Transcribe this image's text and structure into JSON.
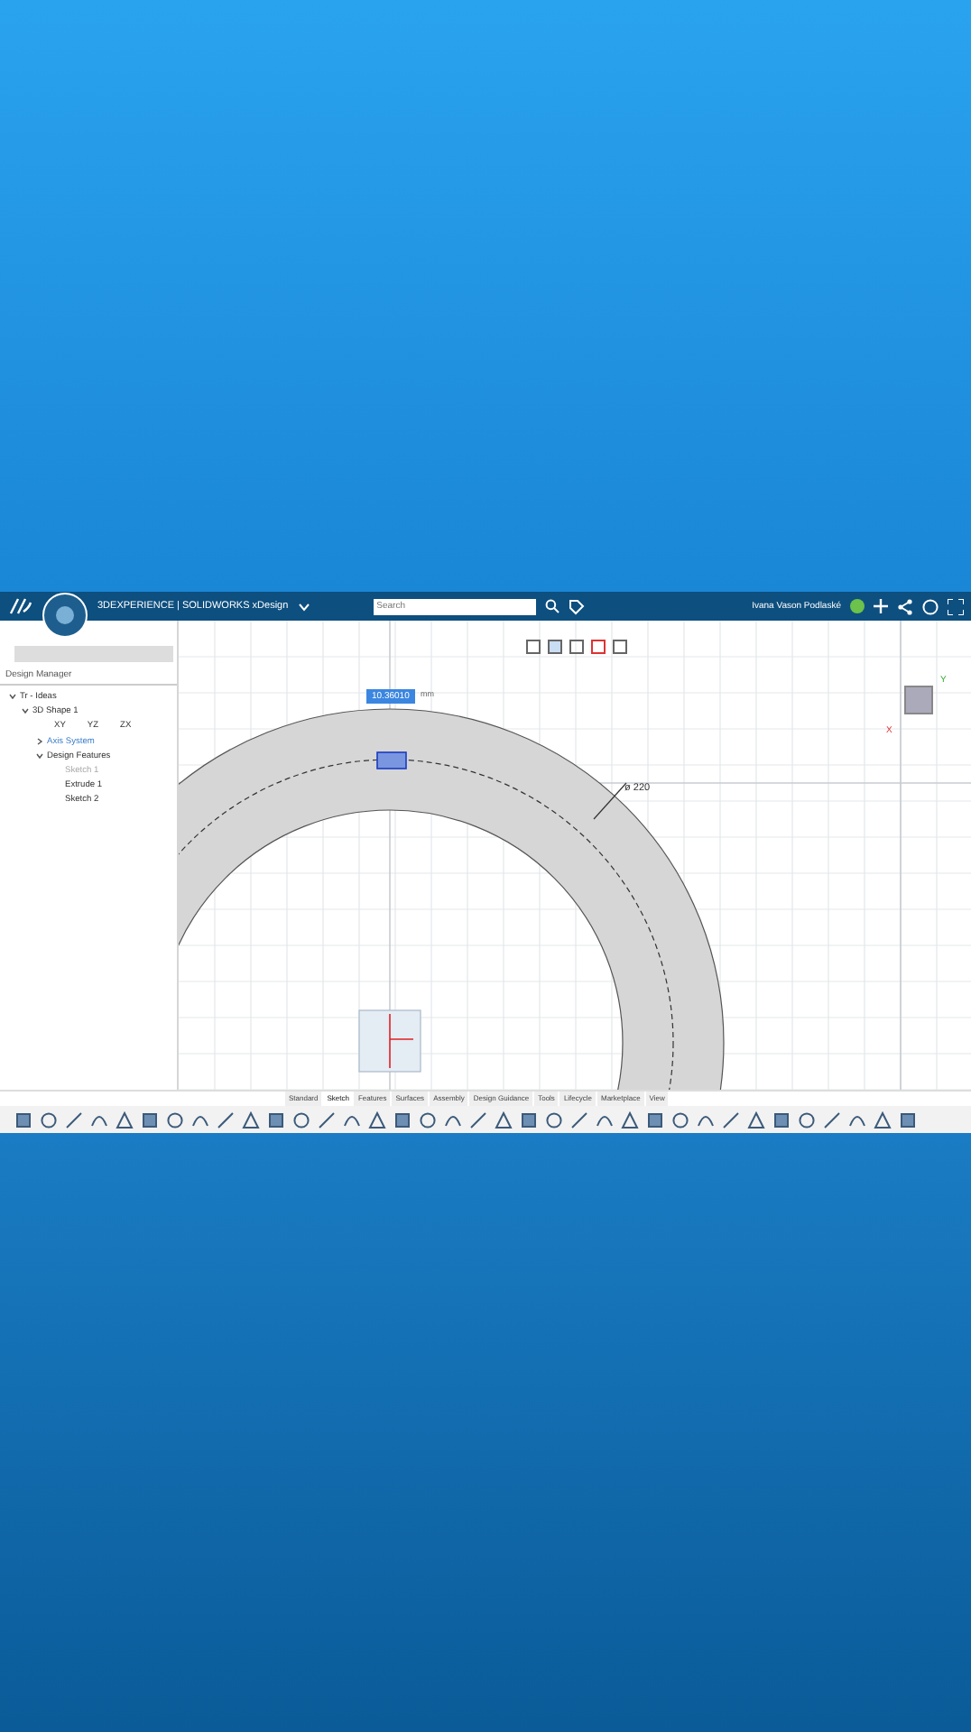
{
  "header": {
    "title": "3DEXPERIENCE | SOLIDWORKS xDesign",
    "search_placeholder": "Search",
    "user": "Ivana Vason Podlaské"
  },
  "sidebar": {
    "title": "Design Manager",
    "planes": [
      "XY",
      "YZ",
      "ZX"
    ],
    "tree": [
      {
        "label": "Tr - Ideas",
        "expanded": true,
        "children": [
          {
            "label": "3D Shape 1",
            "expanded": true,
            "children": [
              {
                "label": "Axis System",
                "expanded": false
              },
              {
                "label": "Design Features",
                "expanded": true,
                "children": [
                  {
                    "label": "Sketch 1",
                    "disabled": true
                  },
                  {
                    "label": "Extrude 1",
                    "disabled": false
                  },
                  {
                    "label": "Sketch 2",
                    "disabled": false
                  }
                ]
              }
            ]
          }
        ]
      }
    ]
  },
  "canvas": {
    "dimension_input": "10.36010",
    "unit": "mm",
    "diameter_label": "ø 220",
    "axis_y": "Y",
    "axis_x": "X"
  },
  "tabs": [
    {
      "label": "Standard",
      "selected": false
    },
    {
      "label": "Sketch",
      "selected": true
    },
    {
      "label": "Features",
      "selected": false
    },
    {
      "label": "Surfaces",
      "selected": false
    },
    {
      "label": "Assembly",
      "selected": false
    },
    {
      "label": "Design Guidance",
      "selected": false
    },
    {
      "label": "Tools",
      "selected": false
    },
    {
      "label": "Lifecycle",
      "selected": false
    },
    {
      "label": "Marketplace",
      "selected": false
    },
    {
      "label": "View",
      "selected": false
    }
  ]
}
